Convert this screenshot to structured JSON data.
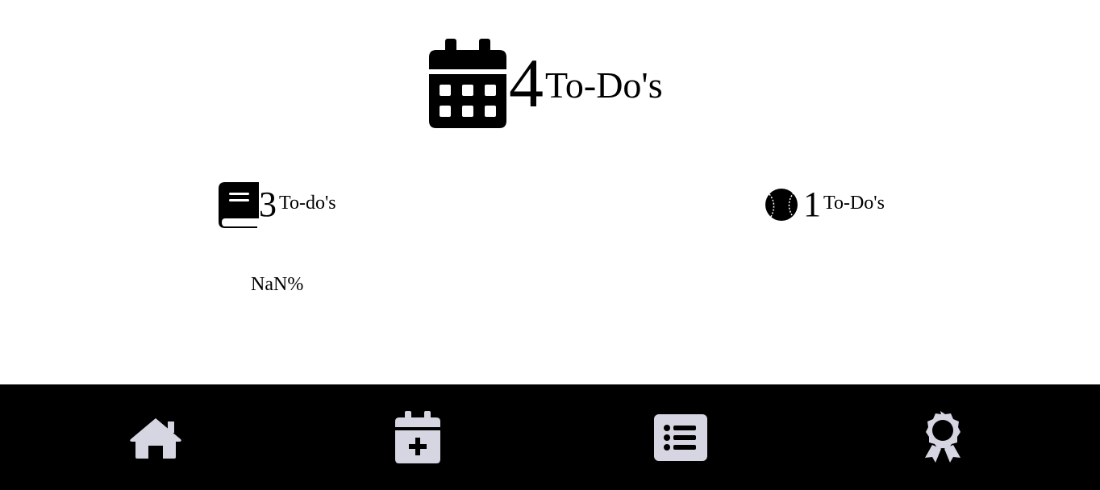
{
  "summary": {
    "total_count": "4",
    "total_label": "To-Do's",
    "icon": "calendar-icon"
  },
  "categories": [
    {
      "icon": "book-icon",
      "count": "3",
      "label": "To-do's"
    },
    {
      "icon": "baseball-icon",
      "count": "1",
      "label": "To-Do's"
    }
  ],
  "progress": {
    "percent_text": "NaN%"
  },
  "nav": {
    "items": [
      {
        "icon": "home-icon"
      },
      {
        "icon": "calendar-plus-icon"
      },
      {
        "icon": "list-icon"
      },
      {
        "icon": "award-icon"
      }
    ],
    "background": "#000000",
    "icon_color": "#d6d6e2"
  }
}
